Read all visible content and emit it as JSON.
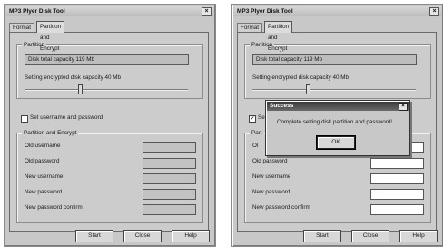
{
  "windows": [
    {
      "title": "MP3 Plyer Disk Tool",
      "close_glyph": "×",
      "tabs": [
        "Format",
        "Partition and Encrypt"
      ],
      "partition": {
        "group_title": "Partition",
        "disk_total": "Disk total capacity 119 Mb",
        "encrypted_label": "Setting encrypted disk capacity 40 Mb",
        "slider_fraction": 0.34
      },
      "set_username": {
        "label": "Set username and password",
        "checked": false,
        "mark": ""
      },
      "encrypt": {
        "group_title": "Partition and Encrypt",
        "fields": [
          {
            "label": "Old username"
          },
          {
            "label": "Old password"
          },
          {
            "label": "New username"
          },
          {
            "label": "New password"
          },
          {
            "label": "New password confirm"
          }
        ],
        "enabled": false
      },
      "buttons": {
        "start": "Start",
        "close": "Close",
        "help": "Help"
      }
    },
    {
      "title": "MP3 Plyer Disk Tool",
      "close_glyph": "×",
      "tabs": [
        "Format",
        "Partition and Encrypt"
      ],
      "partition": {
        "group_title": "Partition",
        "disk_total": "Disk total capacity 119 Mb",
        "encrypted_label": "Setting encrypted disk capacity 40 Mb",
        "slider_fraction": 0.34
      },
      "set_username": {
        "label": "Set username and password",
        "checked": true,
        "mark": "✓",
        "visible_label": "Se"
      },
      "encrypt": {
        "group_title": "Part",
        "fields": [
          {
            "label": "Ol"
          },
          {
            "label": "Old password"
          },
          {
            "label": "New username"
          },
          {
            "label": "New password"
          },
          {
            "label": "New password confirm"
          }
        ],
        "enabled": true
      },
      "buttons": {
        "start": "Start",
        "close": "Close",
        "help": "Help"
      },
      "dialog": {
        "title": "Success",
        "close_glyph": "×",
        "message": "Complete setting disk partition and password!",
        "ok_label": "OK"
      }
    }
  ]
}
